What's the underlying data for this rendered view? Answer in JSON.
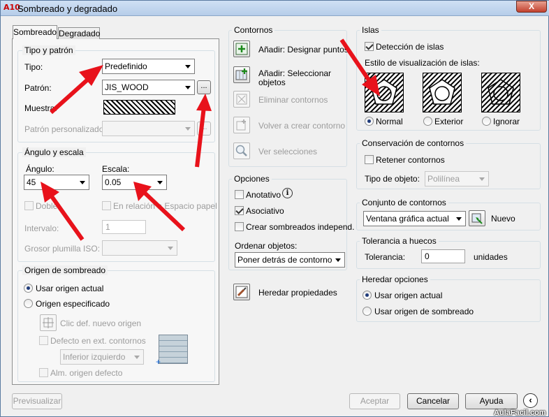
{
  "window": {
    "title": "Sombreado y degradado",
    "app_icon": "A10",
    "close_label": "X"
  },
  "tabs": [
    {
      "label": "Sombreado"
    },
    {
      "label": "Degradado"
    }
  ],
  "tipo_patron": {
    "legend": "Tipo y patrón",
    "tipo_label": "Tipo:",
    "tipo_value": "Predefinido",
    "patron_label": "Patrón:",
    "patron_value": "JIS_WOOD",
    "browse_label": "...",
    "muestra_label": "Muestra:",
    "patron_personalizado_label": "Patrón personalizado:"
  },
  "angulo_escala": {
    "legend": "Ángulo y escala",
    "angulo_label": "Ángulo:",
    "angulo_value": "45",
    "escala_label": "Escala:",
    "escala_value": "0.05",
    "doble_label": "Doble",
    "relacion_label": "En relación a Espacio papel",
    "intervalo_label": "Intervalo:",
    "intervalo_value": "1",
    "grosor_label": "Grosor plumilla ISO:"
  },
  "origen": {
    "legend": "Origen de sombreado",
    "usar_actual": "Usar origen actual",
    "especificado": "Origen especificado",
    "clic_nuevo": "Clic def. nuevo origen",
    "defecto_ext": "Defecto en ext. contornos",
    "inferior_izquierdo": "Inferior izquierdo",
    "alm_origen": "Alm. origen defecto"
  },
  "contornos": {
    "legend": "Contornos",
    "anadir_puntos": "Añadir: Designar puntos",
    "anadir_objetos": "Añadir: Seleccionar objetos",
    "eliminar": "Eliminar contornos",
    "volver": "Volver a crear contorno",
    "ver": "Ver selecciones"
  },
  "opciones": {
    "legend": "Opciones",
    "anotativo": "Anotativo",
    "asociativo": "Asociativo",
    "crear_independ": "Crear sombreados independ.",
    "ordenar_label": "Ordenar objetos:",
    "ordenar_value": "Poner detrás de contorno"
  },
  "heredar_propiedades": "Heredar propiedades",
  "islas": {
    "legend": "Islas",
    "deteccion": "Detección de islas",
    "estilo_label": "Estilo de visualización de islas:",
    "normal": "Normal",
    "exterior": "Exterior",
    "ignorar": "Ignorar"
  },
  "conservacion": {
    "legend": "Conservación de contornos",
    "retener": "Retener contornos",
    "tipo_objeto_label": "Tipo de objeto:",
    "tipo_objeto_value": "Polilínea"
  },
  "conjunto": {
    "legend": "Conjunto de contornos",
    "value": "Ventana gráfica actual",
    "nuevo": "Nuevo"
  },
  "tolerancia": {
    "legend": "Tolerancia a huecos",
    "label": "Tolerancia:",
    "value": "0",
    "unidades": "unidades"
  },
  "heredar_opciones": {
    "legend": "Heredar opciones",
    "usar_actual": "Usar origen actual",
    "usar_sombreado": "Usar origen de sombreado"
  },
  "footer": {
    "previsualizar": "Previsualizar",
    "aceptar": "Aceptar",
    "cancelar": "Cancelar",
    "ayuda": "Ayuda"
  },
  "watermark": "AulaFacil.com",
  "colors": {
    "annotation_arrow": "#e8121b",
    "titlebar": "#c4d8ef",
    "close_button": "#c2412e"
  }
}
